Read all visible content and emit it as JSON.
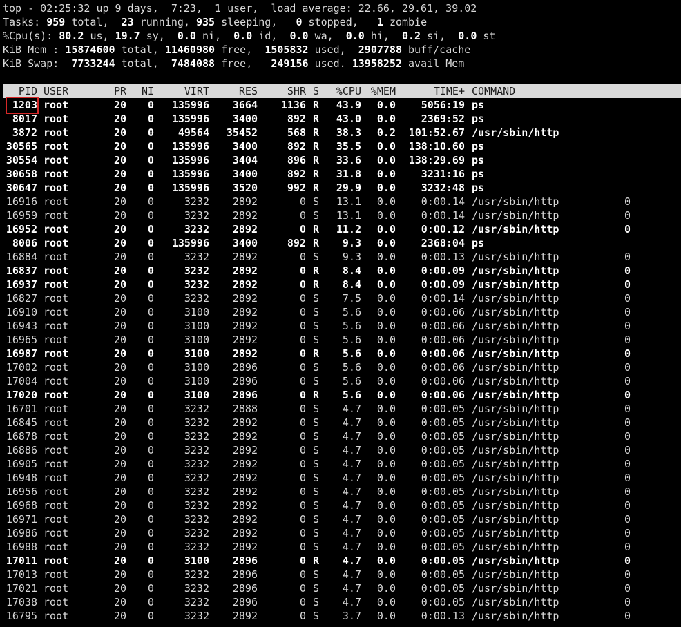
{
  "summary": {
    "line1": "top - 02:25:32 up 9 days,  7:23,  1 user,  load average: 22.66, 29.61, 39.02",
    "tasks": {
      "label": "Tasks:",
      "total": "959",
      "total_label": "total,",
      "running": "23",
      "running_label": "running,",
      "sleeping": "935",
      "sleeping_label": "sleeping,",
      "stopped": "0",
      "stopped_label": "stopped,",
      "zombie": "1",
      "zombie_label": "zombie"
    },
    "cpu": {
      "label": "%Cpu(s):",
      "us": "80.2",
      "us_label": "us,",
      "sy": "19.7",
      "sy_label": "sy,",
      "ni": "0.0",
      "ni_label": "ni,",
      "id": "0.0",
      "id_label": "id,",
      "wa": "0.0",
      "wa_label": "wa,",
      "hi": "0.0",
      "hi_label": "hi,",
      "si": "0.2",
      "si_label": "si,",
      "st": "0.0",
      "st_label": "st"
    },
    "mem": {
      "label": "KiB Mem :",
      "total": "15874600",
      "total_label": "total,",
      "free": "11460980",
      "free_label": "free,",
      "used": "1505832",
      "used_label": "used,",
      "buff": "2907788",
      "buff_label": "buff/cache"
    },
    "swap": {
      "label": "KiB Swap:",
      "total": "7733244",
      "total_label": "total,",
      "free": "7484088",
      "free_label": "free,",
      "used": "249156",
      "used_label": "used.",
      "avail": "13958252",
      "avail_label": "avail Mem"
    }
  },
  "columns": [
    "PID",
    "USER",
    "PR",
    "NI",
    "VIRT",
    "RES",
    "SHR",
    "S",
    "%CPU",
    "%MEM",
    "TIME+",
    "COMMAND"
  ],
  "processes": [
    {
      "pid": "1203",
      "user": "root",
      "pr": "20",
      "ni": "0",
      "virt": "135996",
      "res": "3664",
      "shr": "1136",
      "s": "R",
      "cpu": "43.9",
      "mem": "0.0",
      "time": "5056:19",
      "cmd": "ps",
      "extra": ""
    },
    {
      "pid": "8017",
      "user": "root",
      "pr": "20",
      "ni": "0",
      "virt": "135996",
      "res": "3400",
      "shr": "892",
      "s": "R",
      "cpu": "43.0",
      "mem": "0.0",
      "time": "2369:52",
      "cmd": "ps",
      "extra": ""
    },
    {
      "pid": "3872",
      "user": "root",
      "pr": "20",
      "ni": "0",
      "virt": "49564",
      "res": "35452",
      "shr": "568",
      "s": "R",
      "cpu": "38.3",
      "mem": "0.2",
      "time": "101:52.67",
      "cmd": "/usr/sbin/http",
      "extra": ""
    },
    {
      "pid": "30565",
      "user": "root",
      "pr": "20",
      "ni": "0",
      "virt": "135996",
      "res": "3400",
      "shr": "892",
      "s": "R",
      "cpu": "35.5",
      "mem": "0.0",
      "time": "138:10.60",
      "cmd": "ps",
      "extra": ""
    },
    {
      "pid": "30554",
      "user": "root",
      "pr": "20",
      "ni": "0",
      "virt": "135996",
      "res": "3404",
      "shr": "896",
      "s": "R",
      "cpu": "33.6",
      "mem": "0.0",
      "time": "138:29.69",
      "cmd": "ps",
      "extra": ""
    },
    {
      "pid": "30658",
      "user": "root",
      "pr": "20",
      "ni": "0",
      "virt": "135996",
      "res": "3400",
      "shr": "892",
      "s": "R",
      "cpu": "31.8",
      "mem": "0.0",
      "time": "3231:16",
      "cmd": "ps",
      "extra": ""
    },
    {
      "pid": "30647",
      "user": "root",
      "pr": "20",
      "ni": "0",
      "virt": "135996",
      "res": "3520",
      "shr": "992",
      "s": "R",
      "cpu": "29.9",
      "mem": "0.0",
      "time": "3232:48",
      "cmd": "ps",
      "extra": ""
    },
    {
      "pid": "16916",
      "user": "root",
      "pr": "20",
      "ni": "0",
      "virt": "3232",
      "res": "2892",
      "shr": "0",
      "s": "S",
      "cpu": "13.1",
      "mem": "0.0",
      "time": "0:00.14",
      "cmd": "/usr/sbin/http",
      "extra": "0"
    },
    {
      "pid": "16959",
      "user": "root",
      "pr": "20",
      "ni": "0",
      "virt": "3232",
      "res": "2892",
      "shr": "0",
      "s": "S",
      "cpu": "13.1",
      "mem": "0.0",
      "time": "0:00.14",
      "cmd": "/usr/sbin/http",
      "extra": "0"
    },
    {
      "pid": "16952",
      "user": "root",
      "pr": "20",
      "ni": "0",
      "virt": "3232",
      "res": "2892",
      "shr": "0",
      "s": "R",
      "cpu": "11.2",
      "mem": "0.0",
      "time": "0:00.12",
      "cmd": "/usr/sbin/http",
      "extra": "0"
    },
    {
      "pid": "8006",
      "user": "root",
      "pr": "20",
      "ni": "0",
      "virt": "135996",
      "res": "3400",
      "shr": "892",
      "s": "R",
      "cpu": "9.3",
      "mem": "0.0",
      "time": "2368:04",
      "cmd": "ps",
      "extra": ""
    },
    {
      "pid": "16884",
      "user": "root",
      "pr": "20",
      "ni": "0",
      "virt": "3232",
      "res": "2892",
      "shr": "0",
      "s": "S",
      "cpu": "9.3",
      "mem": "0.0",
      "time": "0:00.13",
      "cmd": "/usr/sbin/http",
      "extra": "0"
    },
    {
      "pid": "16837",
      "user": "root",
      "pr": "20",
      "ni": "0",
      "virt": "3232",
      "res": "2892",
      "shr": "0",
      "s": "R",
      "cpu": "8.4",
      "mem": "0.0",
      "time": "0:00.09",
      "cmd": "/usr/sbin/http",
      "extra": "0"
    },
    {
      "pid": "16937",
      "user": "root",
      "pr": "20",
      "ni": "0",
      "virt": "3232",
      "res": "2892",
      "shr": "0",
      "s": "R",
      "cpu": "8.4",
      "mem": "0.0",
      "time": "0:00.09",
      "cmd": "/usr/sbin/http",
      "extra": "0"
    },
    {
      "pid": "16827",
      "user": "root",
      "pr": "20",
      "ni": "0",
      "virt": "3232",
      "res": "2892",
      "shr": "0",
      "s": "S",
      "cpu": "7.5",
      "mem": "0.0",
      "time": "0:00.14",
      "cmd": "/usr/sbin/http",
      "extra": "0"
    },
    {
      "pid": "16910",
      "user": "root",
      "pr": "20",
      "ni": "0",
      "virt": "3100",
      "res": "2892",
      "shr": "0",
      "s": "S",
      "cpu": "5.6",
      "mem": "0.0",
      "time": "0:00.06",
      "cmd": "/usr/sbin/http",
      "extra": "0"
    },
    {
      "pid": "16943",
      "user": "root",
      "pr": "20",
      "ni": "0",
      "virt": "3100",
      "res": "2892",
      "shr": "0",
      "s": "S",
      "cpu": "5.6",
      "mem": "0.0",
      "time": "0:00.06",
      "cmd": "/usr/sbin/http",
      "extra": "0"
    },
    {
      "pid": "16965",
      "user": "root",
      "pr": "20",
      "ni": "0",
      "virt": "3100",
      "res": "2892",
      "shr": "0",
      "s": "S",
      "cpu": "5.6",
      "mem": "0.0",
      "time": "0:00.06",
      "cmd": "/usr/sbin/http",
      "extra": "0"
    },
    {
      "pid": "16987",
      "user": "root",
      "pr": "20",
      "ni": "0",
      "virt": "3100",
      "res": "2892",
      "shr": "0",
      "s": "R",
      "cpu": "5.6",
      "mem": "0.0",
      "time": "0:00.06",
      "cmd": "/usr/sbin/http",
      "extra": "0"
    },
    {
      "pid": "17002",
      "user": "root",
      "pr": "20",
      "ni": "0",
      "virt": "3100",
      "res": "2896",
      "shr": "0",
      "s": "S",
      "cpu": "5.6",
      "mem": "0.0",
      "time": "0:00.06",
      "cmd": "/usr/sbin/http",
      "extra": "0"
    },
    {
      "pid": "17004",
      "user": "root",
      "pr": "20",
      "ni": "0",
      "virt": "3100",
      "res": "2896",
      "shr": "0",
      "s": "S",
      "cpu": "5.6",
      "mem": "0.0",
      "time": "0:00.06",
      "cmd": "/usr/sbin/http",
      "extra": "0"
    },
    {
      "pid": "17020",
      "user": "root",
      "pr": "20",
      "ni": "0",
      "virt": "3100",
      "res": "2896",
      "shr": "0",
      "s": "R",
      "cpu": "5.6",
      "mem": "0.0",
      "time": "0:00.06",
      "cmd": "/usr/sbin/http",
      "extra": "0"
    },
    {
      "pid": "16701",
      "user": "root",
      "pr": "20",
      "ni": "0",
      "virt": "3232",
      "res": "2888",
      "shr": "0",
      "s": "S",
      "cpu": "4.7",
      "mem": "0.0",
      "time": "0:00.05",
      "cmd": "/usr/sbin/http",
      "extra": "0"
    },
    {
      "pid": "16845",
      "user": "root",
      "pr": "20",
      "ni": "0",
      "virt": "3232",
      "res": "2892",
      "shr": "0",
      "s": "S",
      "cpu": "4.7",
      "mem": "0.0",
      "time": "0:00.05",
      "cmd": "/usr/sbin/http",
      "extra": "0"
    },
    {
      "pid": "16878",
      "user": "root",
      "pr": "20",
      "ni": "0",
      "virt": "3232",
      "res": "2892",
      "shr": "0",
      "s": "S",
      "cpu": "4.7",
      "mem": "0.0",
      "time": "0:00.05",
      "cmd": "/usr/sbin/http",
      "extra": "0"
    },
    {
      "pid": "16886",
      "user": "root",
      "pr": "20",
      "ni": "0",
      "virt": "3232",
      "res": "2892",
      "shr": "0",
      "s": "S",
      "cpu": "4.7",
      "mem": "0.0",
      "time": "0:00.05",
      "cmd": "/usr/sbin/http",
      "extra": "0"
    },
    {
      "pid": "16905",
      "user": "root",
      "pr": "20",
      "ni": "0",
      "virt": "3232",
      "res": "2892",
      "shr": "0",
      "s": "S",
      "cpu": "4.7",
      "mem": "0.0",
      "time": "0:00.05",
      "cmd": "/usr/sbin/http",
      "extra": "0"
    },
    {
      "pid": "16948",
      "user": "root",
      "pr": "20",
      "ni": "0",
      "virt": "3232",
      "res": "2892",
      "shr": "0",
      "s": "S",
      "cpu": "4.7",
      "mem": "0.0",
      "time": "0:00.05",
      "cmd": "/usr/sbin/http",
      "extra": "0"
    },
    {
      "pid": "16956",
      "user": "root",
      "pr": "20",
      "ni": "0",
      "virt": "3232",
      "res": "2892",
      "shr": "0",
      "s": "S",
      "cpu": "4.7",
      "mem": "0.0",
      "time": "0:00.05",
      "cmd": "/usr/sbin/http",
      "extra": "0"
    },
    {
      "pid": "16968",
      "user": "root",
      "pr": "20",
      "ni": "0",
      "virt": "3232",
      "res": "2892",
      "shr": "0",
      "s": "S",
      "cpu": "4.7",
      "mem": "0.0",
      "time": "0:00.05",
      "cmd": "/usr/sbin/http",
      "extra": "0"
    },
    {
      "pid": "16971",
      "user": "root",
      "pr": "20",
      "ni": "0",
      "virt": "3232",
      "res": "2892",
      "shr": "0",
      "s": "S",
      "cpu": "4.7",
      "mem": "0.0",
      "time": "0:00.05",
      "cmd": "/usr/sbin/http",
      "extra": "0"
    },
    {
      "pid": "16986",
      "user": "root",
      "pr": "20",
      "ni": "0",
      "virt": "3232",
      "res": "2892",
      "shr": "0",
      "s": "S",
      "cpu": "4.7",
      "mem": "0.0",
      "time": "0:00.05",
      "cmd": "/usr/sbin/http",
      "extra": "0"
    },
    {
      "pid": "16988",
      "user": "root",
      "pr": "20",
      "ni": "0",
      "virt": "3232",
      "res": "2892",
      "shr": "0",
      "s": "S",
      "cpu": "4.7",
      "mem": "0.0",
      "time": "0:00.05",
      "cmd": "/usr/sbin/http",
      "extra": "0"
    },
    {
      "pid": "17011",
      "user": "root",
      "pr": "20",
      "ni": "0",
      "virt": "3100",
      "res": "2896",
      "shr": "0",
      "s": "R",
      "cpu": "4.7",
      "mem": "0.0",
      "time": "0:00.05",
      "cmd": "/usr/sbin/http",
      "extra": "0"
    },
    {
      "pid": "17013",
      "user": "root",
      "pr": "20",
      "ni": "0",
      "virt": "3232",
      "res": "2896",
      "shr": "0",
      "s": "S",
      "cpu": "4.7",
      "mem": "0.0",
      "time": "0:00.05",
      "cmd": "/usr/sbin/http",
      "extra": "0"
    },
    {
      "pid": "17021",
      "user": "root",
      "pr": "20",
      "ni": "0",
      "virt": "3232",
      "res": "2896",
      "shr": "0",
      "s": "S",
      "cpu": "4.7",
      "mem": "0.0",
      "time": "0:00.05",
      "cmd": "/usr/sbin/http",
      "extra": "0"
    },
    {
      "pid": "17038",
      "user": "root",
      "pr": "20",
      "ni": "0",
      "virt": "3232",
      "res": "2896",
      "shr": "0",
      "s": "S",
      "cpu": "4.7",
      "mem": "0.0",
      "time": "0:00.05",
      "cmd": "/usr/sbin/http",
      "extra": "0"
    },
    {
      "pid": "16795",
      "user": "root",
      "pr": "20",
      "ni": "0",
      "virt": "3232",
      "res": "2892",
      "shr": "0",
      "s": "S",
      "cpu": "3.7",
      "mem": "0.0",
      "time": "0:00.13",
      "cmd": "/usr/sbin/http",
      "extra": "0"
    }
  ]
}
